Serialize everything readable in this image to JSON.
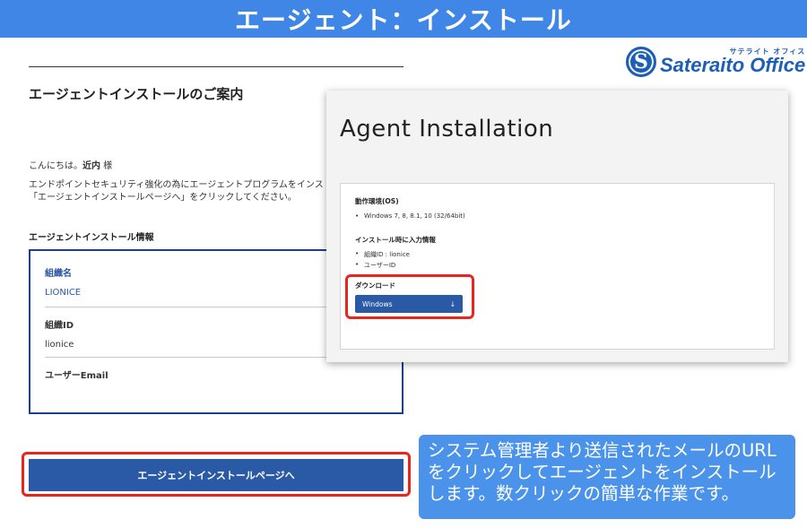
{
  "banner": {
    "title": "エージェント：インストール"
  },
  "logo": {
    "kana": "サテライト オフィス",
    "name": "Sateraito Office",
    "mark": "S"
  },
  "email": {
    "title": "エージェントインストールのご案内",
    "greeting_prefix": "こんにちは。",
    "greeting_name": "近内",
    "greeting_suffix": " 様",
    "intro_line1": "エンドポイントセキュリティ強化の為にエージェントプログラムをインスト",
    "intro_line2": "「エージェントインストールページへ」をクリックしてください。",
    "info_title": "エージェントインストール情報",
    "info": {
      "org_name_label": "組織名",
      "org_name_value": "LIONICE",
      "org_id_label": "組織ID",
      "org_id_value": "lionice",
      "user_email_label": "ユーザーEmail",
      "user_email_value": ""
    },
    "install_button": "エージェントインストールページへ"
  },
  "overlay": {
    "title": "Agent Installation",
    "os_heading": "動作環境(OS)",
    "os_items": [
      "Windows 7, 8, 8.1, 10 (32/64bit)"
    ],
    "input_heading": "インストール時に入力情報",
    "input_items": [
      "組織ID : lionice",
      "ユーザーID"
    ],
    "download_heading": "ダウンロード",
    "windows_button": "Windows",
    "download_arrow": "↓"
  },
  "callout": {
    "line1": "システム管理者より送信されたメールのURL",
    "line2": "をクリックしてエージェントをインストール",
    "line3": "します。数クリックの簡単な作業です。"
  },
  "colors": {
    "banner": "#3f86e6",
    "button": "#2a5aa5",
    "highlight": "#e8261c",
    "callout": "#4b93ea"
  }
}
